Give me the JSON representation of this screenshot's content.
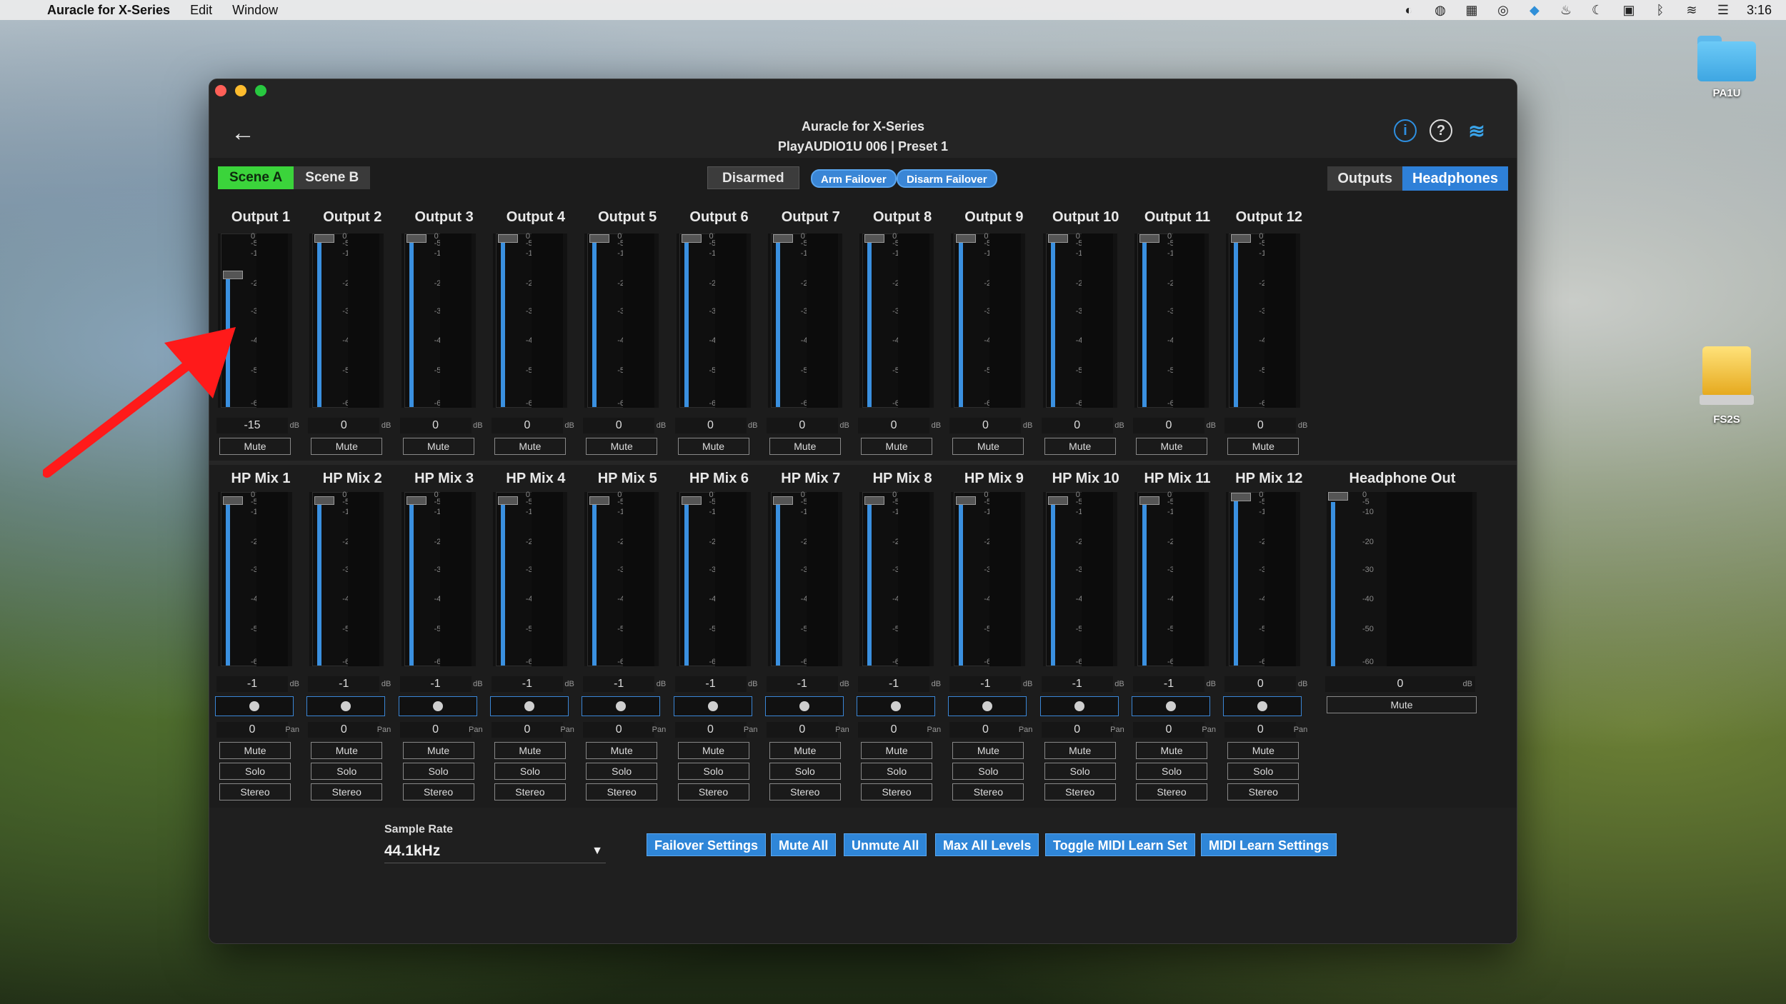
{
  "menubar": {
    "app_name": "Auracle for X-Series",
    "menus": [
      "Edit",
      "Window"
    ],
    "time": "3:16"
  },
  "desktop": {
    "icons": [
      {
        "label": "PA1U"
      },
      {
        "label": "FS2S"
      }
    ]
  },
  "window": {
    "title_line1": "Auracle for X-Series",
    "title_line2": "PlayAUDIO1U 006  |  Preset 1"
  },
  "toolbar": {
    "scene_a": "Scene A",
    "scene_b": "Scene B",
    "arm_state": "Disarmed",
    "arm_failover": "Arm Failover",
    "disarm_failover": "Disarm Failover",
    "view_outputs": "Outputs",
    "view_headphones": "Headphones"
  },
  "scale_labels": [
    "0",
    "-5",
    "-10",
    "-20",
    "-30",
    "-40",
    "-50",
    "-60"
  ],
  "outputs": [
    {
      "label": "Output 1",
      "value": "-15",
      "mute": "Mute",
      "level": 0.78
    },
    {
      "label": "Output 2",
      "value": "0",
      "mute": "Mute",
      "level": 1.0
    },
    {
      "label": "Output 3",
      "value": "0",
      "mute": "Mute",
      "level": 1.0
    },
    {
      "label": "Output 4",
      "value": "0",
      "mute": "Mute",
      "level": 1.0
    },
    {
      "label": "Output 5",
      "value": "0",
      "mute": "Mute",
      "level": 1.0
    },
    {
      "label": "Output 6",
      "value": "0",
      "mute": "Mute",
      "level": 1.0
    },
    {
      "label": "Output 7",
      "value": "0",
      "mute": "Mute",
      "level": 1.0
    },
    {
      "label": "Output 8",
      "value": "0",
      "mute": "Mute",
      "level": 1.0
    },
    {
      "label": "Output 9",
      "value": "0",
      "mute": "Mute",
      "level": 1.0
    },
    {
      "label": "Output 10",
      "value": "0",
      "mute": "Mute",
      "level": 1.0
    },
    {
      "label": "Output 11",
      "value": "0",
      "mute": "Mute",
      "level": 1.0
    },
    {
      "label": "Output 12",
      "value": "0",
      "mute": "Mute",
      "level": 1.0
    }
  ],
  "hp_mixes": [
    {
      "label": "HP Mix 1",
      "value": "-1",
      "pan": "0",
      "mute": "Mute",
      "solo": "Solo",
      "stereo": "Stereo",
      "level": 0.98
    },
    {
      "label": "HP Mix 2",
      "value": "-1",
      "pan": "0",
      "mute": "Mute",
      "solo": "Solo",
      "stereo": "Stereo",
      "level": 0.98
    },
    {
      "label": "HP Mix 3",
      "value": "-1",
      "pan": "0",
      "mute": "Mute",
      "solo": "Solo",
      "stereo": "Stereo",
      "level": 0.98
    },
    {
      "label": "HP Mix 4",
      "value": "-1",
      "pan": "0",
      "mute": "Mute",
      "solo": "Solo",
      "stereo": "Stereo",
      "level": 0.98
    },
    {
      "label": "HP Mix 5",
      "value": "-1",
      "pan": "0",
      "mute": "Mute",
      "solo": "Solo",
      "stereo": "Stereo",
      "level": 0.98
    },
    {
      "label": "HP Mix 6",
      "value": "-1",
      "pan": "0",
      "mute": "Mute",
      "solo": "Solo",
      "stereo": "Stereo",
      "level": 0.98
    },
    {
      "label": "HP Mix 7",
      "value": "-1",
      "pan": "0",
      "mute": "Mute",
      "solo": "Solo",
      "stereo": "Stereo",
      "level": 0.98
    },
    {
      "label": "HP Mix 8",
      "value": "-1",
      "pan": "0",
      "mute": "Mute",
      "solo": "Solo",
      "stereo": "Stereo",
      "level": 0.98
    },
    {
      "label": "HP Mix 9",
      "value": "-1",
      "pan": "0",
      "mute": "Mute",
      "solo": "Solo",
      "stereo": "Stereo",
      "level": 0.98
    },
    {
      "label": "HP Mix 10",
      "value": "-1",
      "pan": "0",
      "mute": "Mute",
      "solo": "Solo",
      "stereo": "Stereo",
      "level": 0.98
    },
    {
      "label": "HP Mix 11",
      "value": "-1",
      "pan": "0",
      "mute": "Mute",
      "solo": "Solo",
      "stereo": "Stereo",
      "level": 0.98
    },
    {
      "label": "HP Mix 12",
      "value": "0",
      "pan": "0",
      "mute": "Mute",
      "solo": "Solo",
      "stereo": "Stereo",
      "level": 1.0
    }
  ],
  "headphone_out": {
    "label": "Headphone Out",
    "value": "0",
    "mute": "Mute",
    "level": 1.0
  },
  "units": {
    "db": "dB",
    "pan": "Pan"
  },
  "bottom": {
    "sample_rate_label": "Sample Rate",
    "sample_rate_value": "44.1kHz",
    "actions": [
      "Failover Settings",
      "Mute All",
      "Unmute All",
      "Max All Levels",
      "Toggle MIDI Learn Set",
      "MIDI Learn Settings"
    ]
  },
  "colors": {
    "accent_blue": "#3a86d6",
    "scene_active": "#3bd43b",
    "annotation_red": "#ff1a1a"
  }
}
